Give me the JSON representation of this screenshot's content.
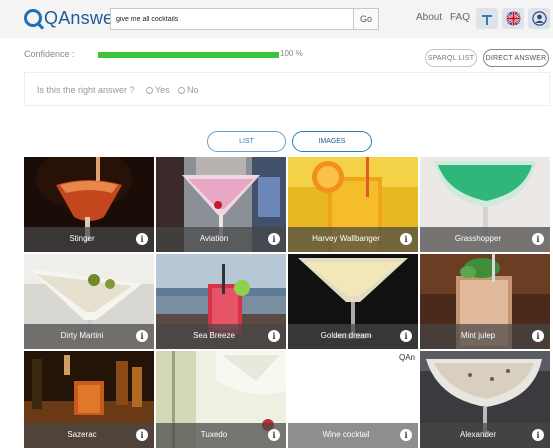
{
  "header": {
    "logo_text": "QAnswer",
    "search_value": "give me all cocktails",
    "go_label": "Go",
    "nav": [
      "About",
      "FAQ"
    ],
    "icons": [
      "tools-icon",
      "uk-flag-icon",
      "user-icon"
    ]
  },
  "confidence": {
    "label": "Confidence :",
    "value_percent": 100,
    "value_text": "100 %"
  },
  "answer_buttons": {
    "sparql": "SPARQL LIST",
    "direct": "DIRECT ANSWER"
  },
  "feedback": {
    "question": "Is this the right answer ?",
    "yes": "Yes",
    "no": "No"
  },
  "view_toggle": {
    "list": "LIST",
    "images": "IMAGES"
  },
  "results": [
    {
      "name": "Stinger"
    },
    {
      "name": "Aviation"
    },
    {
      "name": "Harvey Wallbanger"
    },
    {
      "name": "Grasshopper"
    },
    {
      "name": "Dirty Martini"
    },
    {
      "name": "Sea Breeze"
    },
    {
      "name": "Golden dream"
    },
    {
      "name": "Mint julep"
    },
    {
      "name": "Sazerac"
    },
    {
      "name": "Tuxedo"
    },
    {
      "name": "Wine cocktail",
      "placeholder_text": "QAn"
    },
    {
      "name": "Alexander"
    }
  ],
  "info_glyph": "i",
  "colors": {
    "brand": "#1d5b94",
    "confidence_fill": "#3cc43c",
    "toggle_accent": "#2a7fc0"
  }
}
